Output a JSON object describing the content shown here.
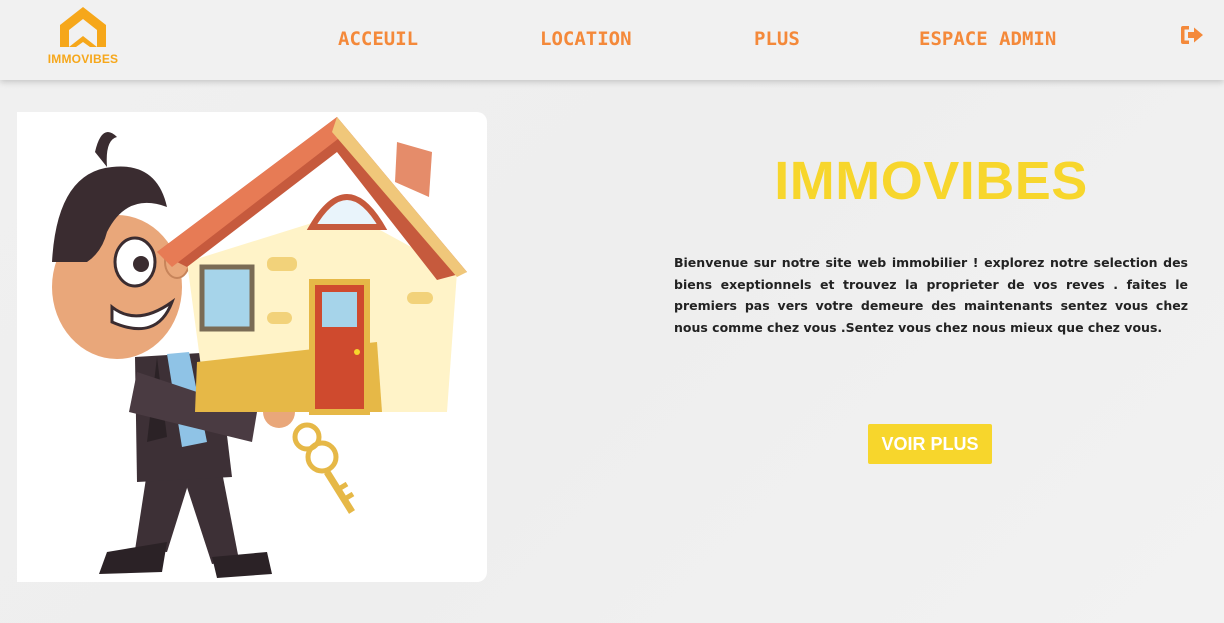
{
  "nav": {
    "logo_text": "IMMOVIBES",
    "links": [
      "ACCEUIL",
      "LOCATION",
      "PLUS",
      "ESPACE ADMIN"
    ],
    "logout_icon": "sign-out-icon"
  },
  "hero": {
    "title": "IMMOVIBES",
    "description": "Bienvenue sur notre site web immobilier ! explorez notre selection des biens exeptionnels et trouvez la proprieter de vos reves . faites le premiers pas vers votre demeure des maintenants sentez vous chez nous comme chez vous .Sentez vous chez nous mieux que chez vous.",
    "button_label": "VOIR PLUS",
    "illustration": "man-carrying-house-illustration"
  },
  "colors": {
    "accent_orange": "#f4893a",
    "accent_yellow": "#f7d62c",
    "logo_orange": "#f6a71a"
  }
}
